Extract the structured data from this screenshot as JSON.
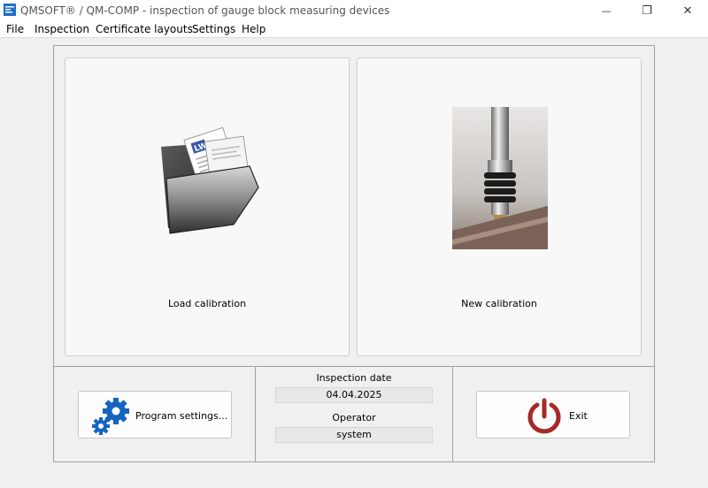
{
  "window": {
    "title": "QMSOFT® / QM-COMP - inspection of gauge block measuring devices",
    "controls": {
      "minimize": "—",
      "maximize": "❐",
      "close": "✕"
    }
  },
  "menu": {
    "items": [
      "File",
      "Inspection",
      "Certificate layouts",
      "Settings",
      "Help"
    ]
  },
  "panels": {
    "load": {
      "label": "Load calibration",
      "icon": "folder-documents-icon"
    },
    "new": {
      "label": "New calibration",
      "icon": "measuring-probe-image"
    }
  },
  "info": {
    "inspection_date_label": "Inspection date",
    "inspection_date": "04.04.2025",
    "operator_label": "Operator",
    "operator": "system"
  },
  "buttons": {
    "settings": {
      "label": "Program settings...",
      "icon": "gears-icon"
    },
    "exit": {
      "label": "Exit",
      "icon": "power-icon"
    }
  },
  "colors": {
    "gears": "#1565c0",
    "power": "#a52a2a",
    "app_icon": "#1e6fc8"
  },
  "logo_text": "LW"
}
